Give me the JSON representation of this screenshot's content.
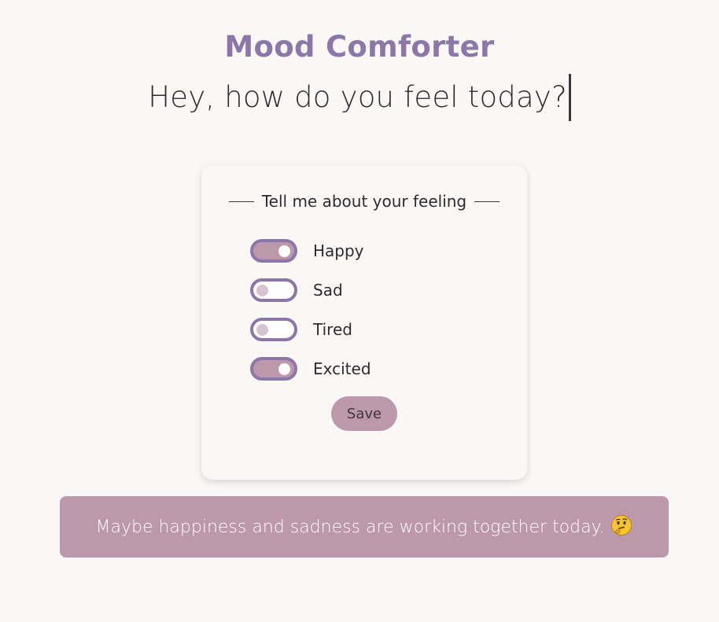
{
  "header": {
    "title": "Mood Comforter",
    "typed_question": "Hey, how do you feel today?"
  },
  "card": {
    "legend": "Tell me about your feeling",
    "toggles": [
      {
        "label": "Happy",
        "checked": true
      },
      {
        "label": "Sad",
        "checked": false
      },
      {
        "label": "Tired",
        "checked": false
      },
      {
        "label": "Excited",
        "checked": true
      }
    ],
    "save_label": "Save"
  },
  "message": {
    "text": "Maybe happiness and sadness are working together today.",
    "emoji_icon": "thinking-face-icon"
  },
  "colors": {
    "accent_purple": "#8c77a8",
    "pink": "#bd98ad",
    "background": "#faf8f7"
  }
}
